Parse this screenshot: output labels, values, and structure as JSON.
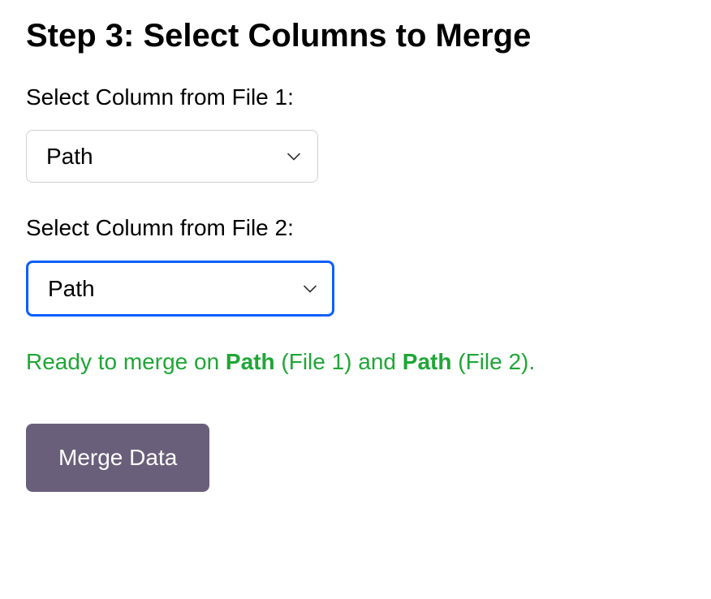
{
  "heading": "Step 3: Select Columns to Merge",
  "file1": {
    "label": "Select Column from File 1:",
    "selected": "Path"
  },
  "file2": {
    "label": "Select Column from File 2:",
    "selected": "Path"
  },
  "status": {
    "prefix": "Ready to merge on ",
    "col1": "Path",
    "mid1": " (File 1) and ",
    "col2": "Path",
    "mid2": " (File 2)."
  },
  "button": {
    "merge": "Merge Data"
  }
}
